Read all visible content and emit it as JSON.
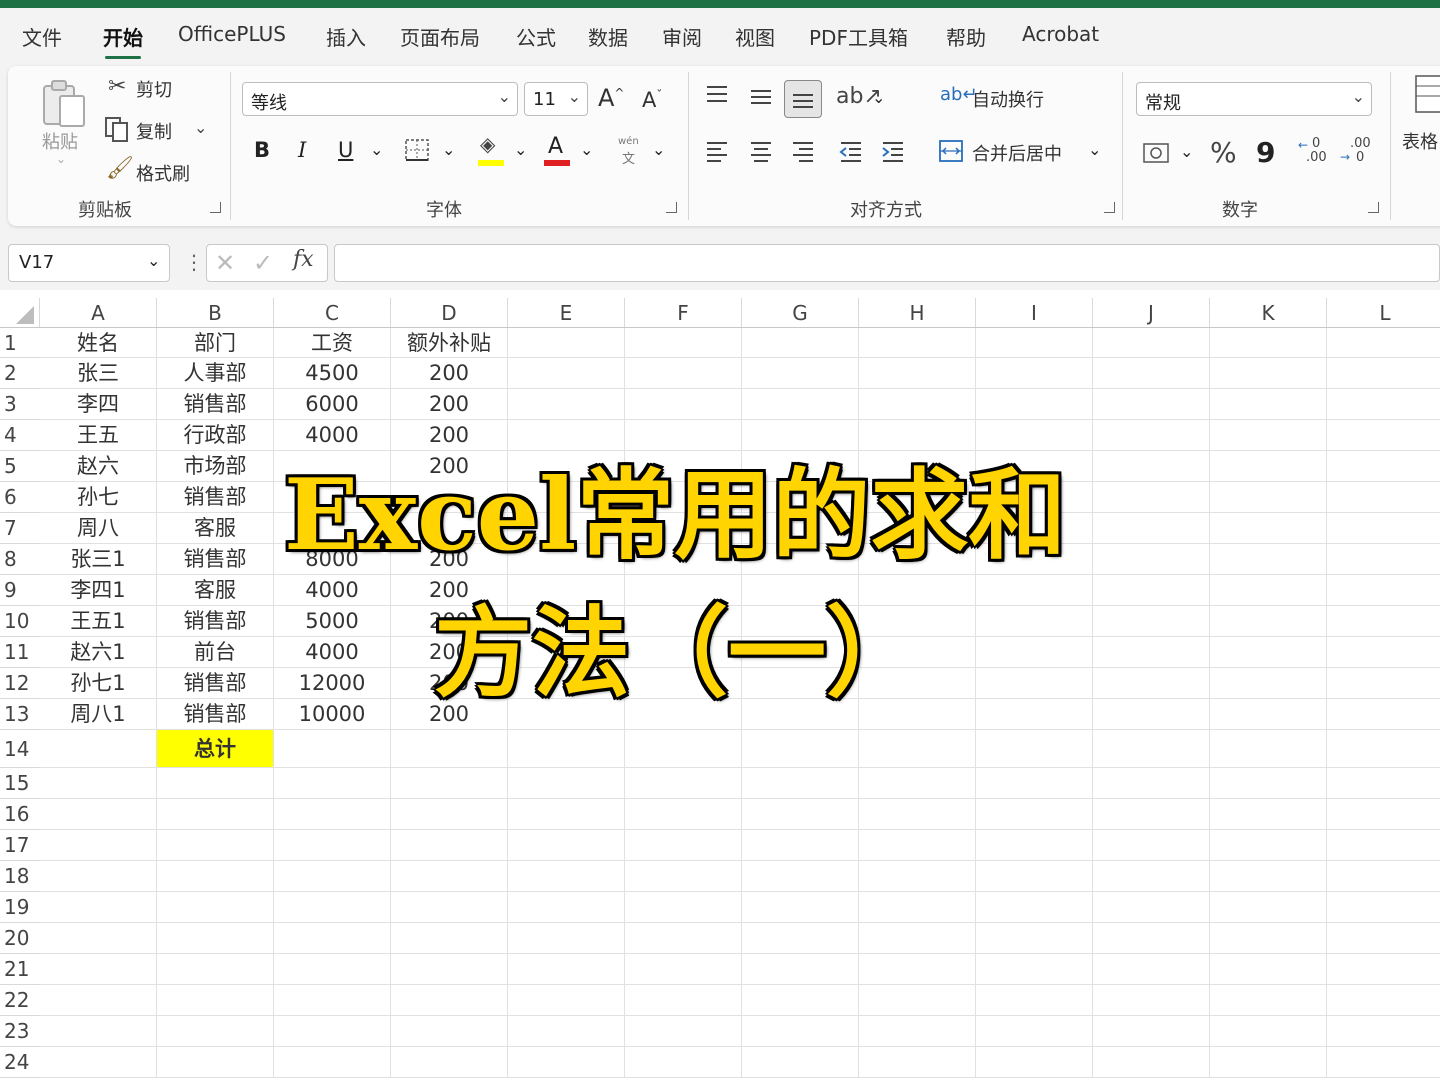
{
  "tabs": [
    "文件",
    "开始",
    "OfficePLUS",
    "插入",
    "页面布局",
    "公式",
    "数据",
    "审阅",
    "视图",
    "PDF工具箱",
    "帮助",
    "Acrobat"
  ],
  "active_tab": "开始",
  "ribbon": {
    "clipboard": {
      "paste": "粘贴",
      "cut": "剪切",
      "copy": "复制",
      "format_painter": "格式刷",
      "label": "剪贴板"
    },
    "font": {
      "name": "等线",
      "size": "11",
      "grow": "A",
      "shrink": "A",
      "bold": "B",
      "italic": "I",
      "underline": "U",
      "label": "字体",
      "phonetic_top": "wén",
      "phonetic_bottom": "文"
    },
    "alignment": {
      "wrap": "自动换行",
      "merge": "合并后居中",
      "label": "对齐方式"
    },
    "number": {
      "format": "常规",
      "percent": "%",
      "comma": "9",
      "inc_top": "0",
      "inc_bottom": ".00",
      "dec_top": ".00",
      "dec_bottom": "0",
      "label": "数字"
    },
    "styles": {
      "table_format": "表格"
    }
  },
  "formula_bar": {
    "name_box": "V17",
    "fx": "fx",
    "value": ""
  },
  "columns": [
    "A",
    "B",
    "C",
    "D",
    "E",
    "F",
    "G",
    "H",
    "I",
    "J",
    "K",
    "L"
  ],
  "rows": [
    "1",
    "2",
    "3",
    "4",
    "5",
    "6",
    "7",
    "8",
    "9",
    "10",
    "11",
    "12",
    "13",
    "14",
    "15",
    "16",
    "17",
    "18",
    "19",
    "20",
    "21",
    "22",
    "23",
    "24"
  ],
  "table": {
    "header": [
      "姓名",
      "部门",
      "工资",
      "额外补贴"
    ],
    "data": [
      [
        "张三",
        "人事部",
        "4500",
        "200"
      ],
      [
        "李四",
        "销售部",
        "6000",
        "200"
      ],
      [
        "王五",
        "行政部",
        "4000",
        "200"
      ],
      [
        "赵六",
        "市场部",
        "",
        "200"
      ],
      [
        "孙七",
        "销售部",
        "",
        ""
      ],
      [
        "周八",
        "客服",
        "",
        ""
      ],
      [
        "张三1",
        "销售部",
        "8000",
        "200"
      ],
      [
        "李四1",
        "客服",
        "4000",
        "200"
      ],
      [
        "王五1",
        "销售部",
        "5000",
        "200"
      ],
      [
        "赵六1",
        "前台",
        "4000",
        "200"
      ],
      [
        "孙七1",
        "销售部",
        "12000",
        "200"
      ],
      [
        "周八1",
        "销售部",
        "10000",
        "200"
      ]
    ],
    "total_label": "总计"
  },
  "overlay": {
    "line1": "Excel常用的求和",
    "line2": "方法（一）"
  },
  "colors": {
    "accent": "#1e7145",
    "highlight": "#ffff00",
    "overlay_text": "#ffd400",
    "font_color_bar": "#e02020",
    "fill_color_bar": "#ffff00"
  }
}
